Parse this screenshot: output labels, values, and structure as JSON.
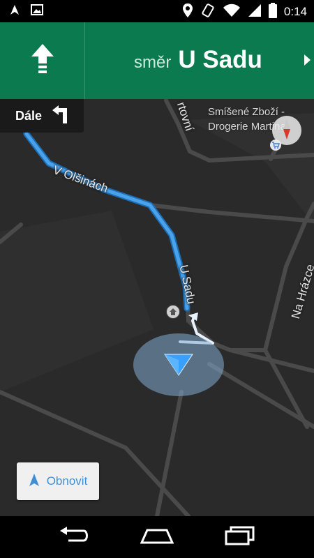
{
  "status_bar": {
    "time": "0:14",
    "left_icons": [
      "location-arrow-icon",
      "image-icon"
    ],
    "right_icons": [
      "location-pin-icon",
      "rotate-phone-icon",
      "wifi-icon",
      "cell-signal-icon",
      "battery-icon"
    ]
  },
  "navigation": {
    "maneuver_icon": "arrow-straight-icon",
    "street_prefix": "směr",
    "street_name": "U Sadu",
    "next_step_icon": "chevron-right-icon",
    "color": "#0b7a4f"
  },
  "then_step": {
    "label": "Dále",
    "icon": "turn-left-icon"
  },
  "map": {
    "poi_name": "Smíšené Zboží - Drogerie Martina",
    "poi_line1": "Smíšené Zboží -",
    "poi_line2": "Drogerie Martina",
    "streets": {
      "v_olsinach": "V Olšinách",
      "u_sadu": "U Sadu",
      "na_hrazce": "Na Hrázce",
      "partial": "rtovní"
    },
    "route_color": "#4aa3ea"
  },
  "refresh_button": {
    "label": "Obnovit",
    "icon": "navigation-arrow-icon"
  },
  "system_nav": {
    "buttons": [
      "back-icon",
      "home-icon",
      "recents-icon"
    ]
  }
}
